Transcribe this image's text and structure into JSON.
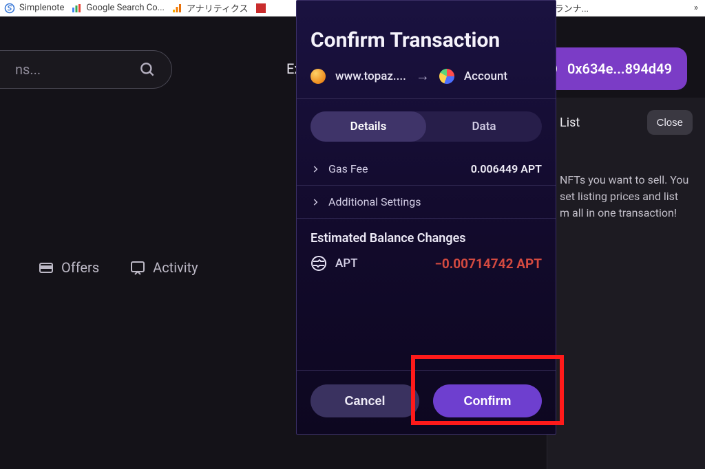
{
  "bookmarks": {
    "b1": "Simplenote",
    "b2": "Google Search Co...",
    "b3": "アナリティクス",
    "b5": "ド プランナ...",
    "more": "»"
  },
  "search": {
    "placeholder": "ns..."
  },
  "nav": {
    "explore": "Exp",
    "offers": "Offers",
    "activity": "Activity"
  },
  "wallet_button": {
    "address": "0x634e...894d49"
  },
  "drawer": {
    "list_label": "List",
    "close": "Close",
    "text_line1": "NFTs you want to sell. You",
    "text_line2": "set listing prices and list",
    "text_line3": "m all in one transaction!"
  },
  "popup": {
    "title": "Confirm Transaction",
    "site": "www.topaz....",
    "account": "Account",
    "tab_details": "Details",
    "tab_data": "Data",
    "gas_label": "Gas Fee",
    "gas_value": "0.006449 APT",
    "addl_label": "Additional Settings",
    "ebc_title": "Estimated Balance Changes",
    "token_symbol": "APT",
    "ebc_amount": "−0.00714742 APT",
    "cancel": "Cancel",
    "confirm": "Confirm"
  }
}
